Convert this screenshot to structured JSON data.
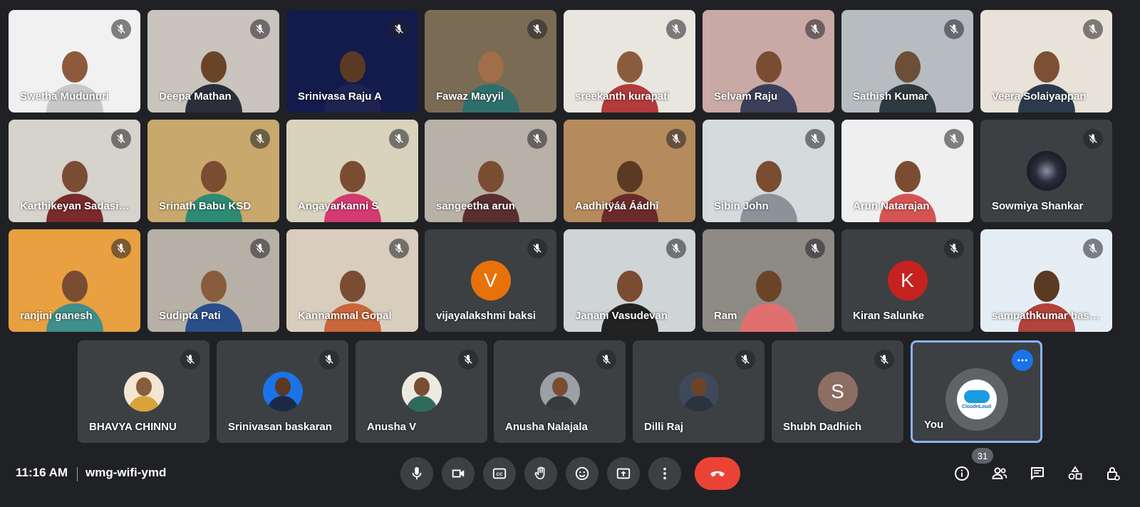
{
  "rows": [
    [
      {
        "name": "Swetha Mudunuri",
        "bg": "#f1f1f1",
        "skin": "#8d5a3b",
        "shirt": "#c8c8c8",
        "mic": "muted"
      },
      {
        "name": "Deepa Mathan",
        "bg": "#c9c4bd",
        "skin": "#6b4428",
        "shirt": "#2b2f3a",
        "mic": "muted"
      },
      {
        "name": "Srinivasa Raju A",
        "bg": "#131b4d",
        "skin": "#5a3a22",
        "shirt": "#1e2350",
        "mic": "muted"
      },
      {
        "name": "Fawaz Mayyil",
        "bg": "#7a6b55",
        "skin": "#a06e49",
        "shirt": "#2f6f6b",
        "mic": "muted"
      },
      {
        "name": "sreekanth kurapati",
        "bg": "#e9e5df",
        "skin": "#8a5c3e",
        "shirt": "#b23b3b",
        "mic": "muted"
      },
      {
        "name": "Selvam Raju",
        "bg": "#c9a9a6",
        "skin": "#7a4d32",
        "shirt": "#3b3f59",
        "mic": "muted"
      },
      {
        "name": "Sathish Kumar",
        "bg": "#b7bcc0",
        "skin": "#6d4e39",
        "shirt": "#2f3a40",
        "mic": "muted"
      },
      {
        "name": "Veera Solaiyappan",
        "bg": "#e8e2d8",
        "skin": "#7b5034",
        "shirt": "#2c3a4c",
        "mic": "muted"
      }
    ],
    [
      {
        "name": "Karthikeyan Sadasivam",
        "bg": "#d6d2cc",
        "skin": "#7a4d32",
        "shirt": "#7a2a2a",
        "mic": "muted"
      },
      {
        "name": "Srinath Babu KSD",
        "bg": "#c8a86c",
        "skin": "#7a4d32",
        "shirt": "#2d8a74",
        "mic": "muted"
      },
      {
        "name": "Angayarkanni S",
        "bg": "#d9d3bd",
        "skin": "#7a4d32",
        "shirt": "#d33a6f",
        "mic": "muted"
      },
      {
        "name": "sangeetha arun",
        "bg": "#b8b1a7",
        "skin": "#7a4d32",
        "shirt": "#5a2e2e",
        "mic": "muted"
      },
      {
        "name": "Aadhitÿáá Áádhî",
        "bg": "#b58a5c",
        "skin": "#5a3a22",
        "shirt": "#6b2a2a",
        "mic": "muted"
      },
      {
        "name": "Sibin John",
        "bg": "#d5dadd",
        "skin": "#7a4d32",
        "shirt": "#8c9299",
        "mic": "muted"
      },
      {
        "name": "Arun Natarajan",
        "bg": "#efefef",
        "skin": "#7a4d32",
        "shirt": "#d45454",
        "mic": "muted"
      },
      {
        "name": "Sowmiya Shankar",
        "bg": "#3c4043",
        "avatar": "galaxy",
        "mic": "muted"
      }
    ],
    [
      {
        "name": "ranjini ganesh",
        "bg": "#e8a040",
        "skin": "#7a4d32",
        "shirt": "#3f8f8a",
        "mic": "muted"
      },
      {
        "name": "Sudipta Pati",
        "bg": "#b7b0a6",
        "skin": "#8a5c3e",
        "shirt": "#2b4e8a",
        "mic": "muted"
      },
      {
        "name": "Kannammal Gopal",
        "bg": "#d9cdbd",
        "skin": "#7a4d32",
        "shirt": "#c9663a",
        "mic": "muted"
      },
      {
        "name": "vijayalakshmi baksi",
        "bg": "#3c4043",
        "letter": "V",
        "letter_color": "#e8710a",
        "mic": "muted"
      },
      {
        "name": "Janani Vasudevan",
        "bg": "#cfd4d6",
        "skin": "#7a4d32",
        "shirt": "#222222",
        "mic": "muted"
      },
      {
        "name": "Ram",
        "bg": "#8e8a84",
        "skin": "#6b4428",
        "shirt": "#e07070",
        "mic": "muted"
      },
      {
        "name": "Kiran Salunke",
        "bg": "#3c4043",
        "letter": "K",
        "letter_color": "#c5221f",
        "mic": "muted"
      },
      {
        "name": "sampathkumar baskaran",
        "bg": "#e6eef5",
        "skin": "#5a3a22",
        "shirt": "#b0433a",
        "mic": "muted"
      }
    ]
  ],
  "bottom_row": [
    {
      "name": "BHAVYA CHINNU",
      "photo": {
        "bg": "#f3e6d3",
        "skin": "#8a5c3e",
        "shirt": "#d9a33a"
      },
      "mic": "muted"
    },
    {
      "name": "Srinivasan baskaran",
      "photo": {
        "bg": "#1a73e8",
        "skin": "#5a3a22",
        "shirt": "#1c2a48"
      },
      "mic": "muted"
    },
    {
      "name": "Anusha V",
      "photo": {
        "bg": "#efeae0",
        "skin": "#7a4d32",
        "shirt": "#2e6b5a"
      },
      "mic": "muted"
    },
    {
      "name": "Anusha Nalajala",
      "photo": {
        "bg": "#9aa0a6",
        "skin": "#7a4d32",
        "shirt": "#3a3a3a"
      },
      "mic": "muted"
    },
    {
      "name": "Dilli Raj",
      "photo": {
        "bg": "#3e4a5a",
        "skin": "#6b4428",
        "shirt": "#2b3340"
      },
      "mic": "muted"
    },
    {
      "name": "Shubh Dadhich",
      "letter": "S",
      "letter_color": "#8d6e63",
      "mic": "muted"
    },
    {
      "name": "You",
      "self": true,
      "logo_text": "CloudnLoud",
      "mic": "none"
    }
  ],
  "footer": {
    "time": "11:16 AM",
    "meeting_code": "wmg-wifi-ymd",
    "people_count": "31"
  },
  "colors": {
    "background": "#202124",
    "tile": "#3c4043",
    "end_call": "#ea4335",
    "accent": "#8ab4f8"
  },
  "icons": [
    "mic-icon",
    "camera-icon",
    "captions-icon",
    "raise-hand-icon",
    "emoji-icon",
    "present-icon",
    "more-vert-icon",
    "end-call-icon",
    "info-icon",
    "people-icon",
    "chat-icon",
    "activities-icon",
    "host-controls-icon"
  ]
}
